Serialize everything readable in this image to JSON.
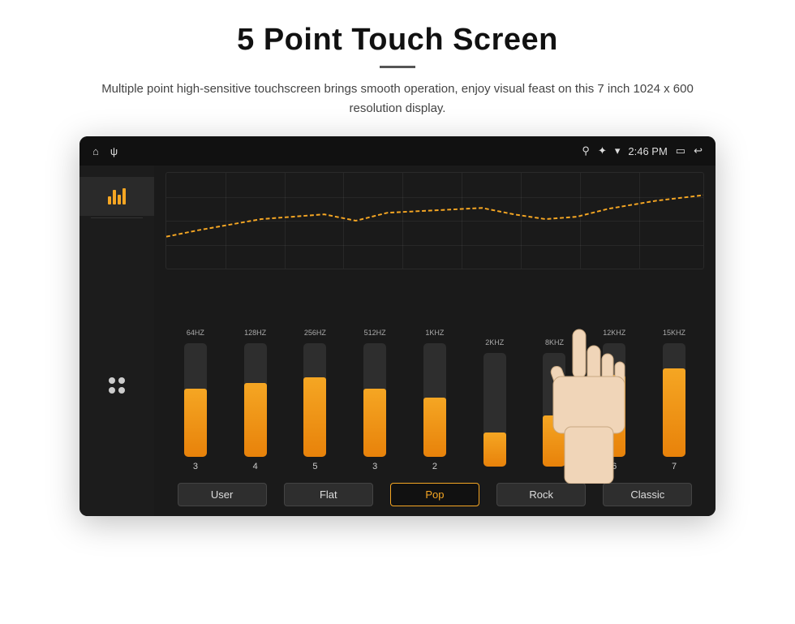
{
  "header": {
    "title": "5 Point Touch Screen",
    "subtitle": "Multiple point high-sensitive touchscreen brings smooth operation, enjoy visual feast on this 7 inch 1024 x 600 resolution display."
  },
  "status_bar": {
    "time": "2:46 PM",
    "icons_left": [
      "home",
      "usb"
    ],
    "icons_right": [
      "location",
      "bluetooth",
      "wifi",
      "time",
      "battery",
      "back"
    ]
  },
  "sidebar": {
    "items": [
      {
        "id": "equalizer",
        "active": true
      },
      {
        "id": "apps"
      }
    ]
  },
  "equalizer": {
    "bands": [
      {
        "freq": "64HZ",
        "value": 3,
        "fill_pct": 60
      },
      {
        "freq": "128HZ",
        "value": 4,
        "fill_pct": 65
      },
      {
        "freq": "256HZ",
        "value": 5,
        "fill_pct": 70
      },
      {
        "freq": "512HZ",
        "value": 3,
        "fill_pct": 60
      },
      {
        "freq": "1KHZ",
        "value": 2,
        "fill_pct": 52
      },
      {
        "freq": "2KHZ",
        "value": null,
        "fill_pct": 30
      },
      {
        "freq": "8KHZ",
        "value": null,
        "fill_pct": 45
      },
      {
        "freq": "12KHZ",
        "value": 6,
        "fill_pct": 72
      },
      {
        "freq": "15KHZ",
        "value": 7,
        "fill_pct": 78
      }
    ],
    "presets": [
      {
        "id": "user",
        "label": "User",
        "active": false
      },
      {
        "id": "flat",
        "label": "Flat",
        "active": false
      },
      {
        "id": "pop",
        "label": "Pop",
        "active": true
      },
      {
        "id": "rock",
        "label": "Rock",
        "active": false
      },
      {
        "id": "classic",
        "label": "Classic",
        "active": false
      }
    ]
  },
  "colors": {
    "orange": "#f5a623",
    "active_border": "#f5a623",
    "inactive_bg": "#2e2e2e"
  }
}
